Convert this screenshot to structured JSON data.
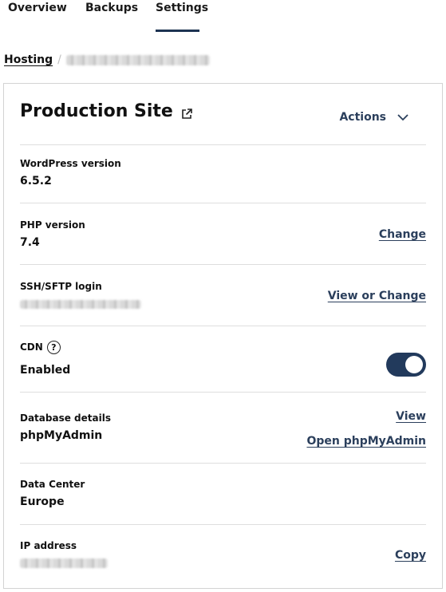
{
  "tabs": [
    {
      "label": "Overview"
    },
    {
      "label": "Backups"
    },
    {
      "label": "Settings",
      "active": true
    }
  ],
  "breadcrumb": {
    "root": "Hosting",
    "separator": "/",
    "current": "dasdasdfsdfasdsdfsa"
  },
  "site": {
    "title": "Production Site",
    "actions_label": "Actions"
  },
  "rows": {
    "wordpress": {
      "label": "WordPress version",
      "value": "6.5.2"
    },
    "php": {
      "label": "PHP version",
      "value": "7.4",
      "link": "Change"
    },
    "ssh": {
      "label": "SSH/SFTP login",
      "value": "dasdasdfsdfasdsd",
      "link": "View or Change"
    },
    "cdn": {
      "label": "CDN",
      "value": "Enabled",
      "enabled": true,
      "help_icon": "question-circle-icon"
    },
    "database": {
      "label": "Database details",
      "value": "phpMyAdmin",
      "link_view": "View",
      "link_open": "Open phpMyAdmin"
    },
    "datacenter": {
      "label": "Data Center",
      "value": "Europe"
    },
    "ip": {
      "label": "IP address",
      "value": "000.000.000.000",
      "link": "Copy"
    }
  },
  "colors": {
    "accent": "#223a5c",
    "link": "#2b3f5c",
    "divider": "#dedede"
  }
}
